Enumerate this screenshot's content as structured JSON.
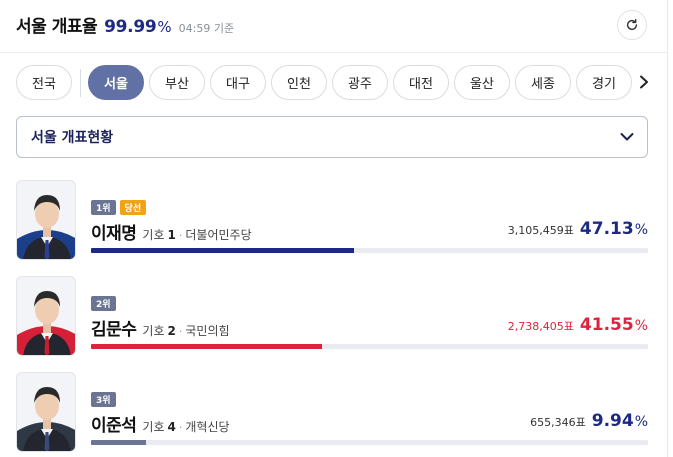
{
  "header": {
    "title": "서울 개표율",
    "progress_value": "99.99",
    "progress_unit": "%",
    "updated_time": "04:59 기준"
  },
  "tabs": [
    {
      "label": "전국",
      "active": false
    },
    {
      "label": "서울",
      "active": true
    },
    {
      "label": "부산",
      "active": false
    },
    {
      "label": "대구",
      "active": false
    },
    {
      "label": "인천",
      "active": false
    },
    {
      "label": "광주",
      "active": false
    },
    {
      "label": "대전",
      "active": false
    },
    {
      "label": "울산",
      "active": false
    },
    {
      "label": "세종",
      "active": false
    },
    {
      "label": "경기",
      "active": false
    }
  ],
  "dropdown": {
    "selected": "서울 개표현황"
  },
  "candidates": [
    {
      "rank": "1위",
      "status": "당선",
      "name": "이재명",
      "number_label": "기호",
      "number": "1",
      "party": "더불어민주당",
      "votes": "3,105,459표",
      "percent": "47.13",
      "percent_unit": "%",
      "share": 47.13,
      "color": "#1c2a86",
      "pct_color": "#1c2a86",
      "votes_color": "#333333",
      "bg_color": "#1c3f8c",
      "tie_color": "#2f3f8f"
    },
    {
      "rank": "2위",
      "status": "",
      "name": "김문수",
      "number_label": "기호",
      "number": "2",
      "party": "국민의힘",
      "votes": "2,738,405표",
      "percent": "41.55",
      "percent_unit": "%",
      "share": 41.55,
      "color": "#e0223c",
      "pct_color": "#e0223c",
      "votes_color": "#e0223c",
      "bg_color": "#d52037",
      "tie_color": "#c41f2f"
    },
    {
      "rank": "3위",
      "status": "",
      "name": "이준석",
      "number_label": "기호",
      "number": "4",
      "party": "개혁신당",
      "votes": "655,346표",
      "percent": "9.94",
      "percent_unit": "%",
      "share": 9.94,
      "color": "#6b7493",
      "pct_color": "#1c2a86",
      "votes_color": "#333333",
      "bg_color": "#2f3946",
      "tie_color": "#3a4a7a"
    }
  ],
  "colors": {
    "accent": "#1c2a86",
    "active_tab": "#6171a5",
    "winner_badge": "#f0a319"
  },
  "icons": {
    "refresh": "refresh-icon",
    "tabs_next": "chevron-right-icon",
    "dropdown": "chevron-down-icon"
  }
}
